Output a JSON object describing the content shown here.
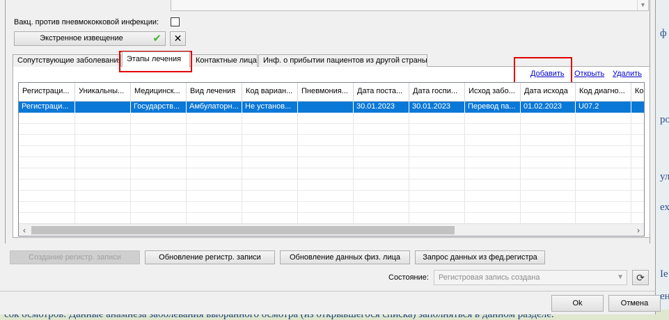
{
  "form": {
    "vaccine_label": "Вакц. против пневмококковой инфекции:",
    "emergency_button": "Экстренное извещение",
    "close_glyph": "✕",
    "check_glyph": "✔"
  },
  "tabs": [
    {
      "label": "Сопутствующие заболевания",
      "active": false
    },
    {
      "label": "Этапы лечения",
      "active": true
    },
    {
      "label": "Контактные лица",
      "active": false
    },
    {
      "label": "Инф. о прибытии пациентов из другой страны",
      "active": false
    }
  ],
  "links": {
    "add": "Добавить",
    "open": "Открыть",
    "delete": "Удалить"
  },
  "grid": {
    "columns": [
      "Регистраци...",
      "Уникальны...",
      "Медицинск...",
      "Вид лечения",
      "Код вариан...",
      "Пневмония...",
      "Дата поста...",
      "Дата госпи...",
      "Исход забо...",
      "Дата исхода",
      "Код диагно...",
      "Ко"
    ],
    "rows": [
      [
        "Регистраци...",
        "",
        "Государств...",
        "Амбулаторн...",
        "Не установ...",
        "",
        "30.01.2023",
        "30.01.2023",
        "Перевод па...",
        "01.02.2023",
        "U07.2",
        ""
      ]
    ],
    "scroll_left": "‹",
    "scroll_right": "›"
  },
  "actions": {
    "create": "Создание регистр. записи",
    "update": "Обновление регистр. записи",
    "update_person": "Обновление данных физ. лица",
    "request": "Запрос данных из фед.регистра"
  },
  "state": {
    "label": "Состояние:",
    "value": "Регистровая запись создана",
    "refresh_glyph": "⟳"
  },
  "footer": {
    "ok": "Ok",
    "cancel": "Отмена"
  },
  "background": {
    "bottom_text": "сок осмотров. Данные анамнеза заболевания выбранного осмотра (из открывшегося списка) заполняться в данном разделе.",
    "right_fragments": [
      "ф",
      "ро",
      "ул",
      "ех",
      "Ie",
      "ен"
    ]
  },
  "colors": {
    "selection": "#0a78d7",
    "link": "#0000cc",
    "highlight": "#e00000"
  }
}
